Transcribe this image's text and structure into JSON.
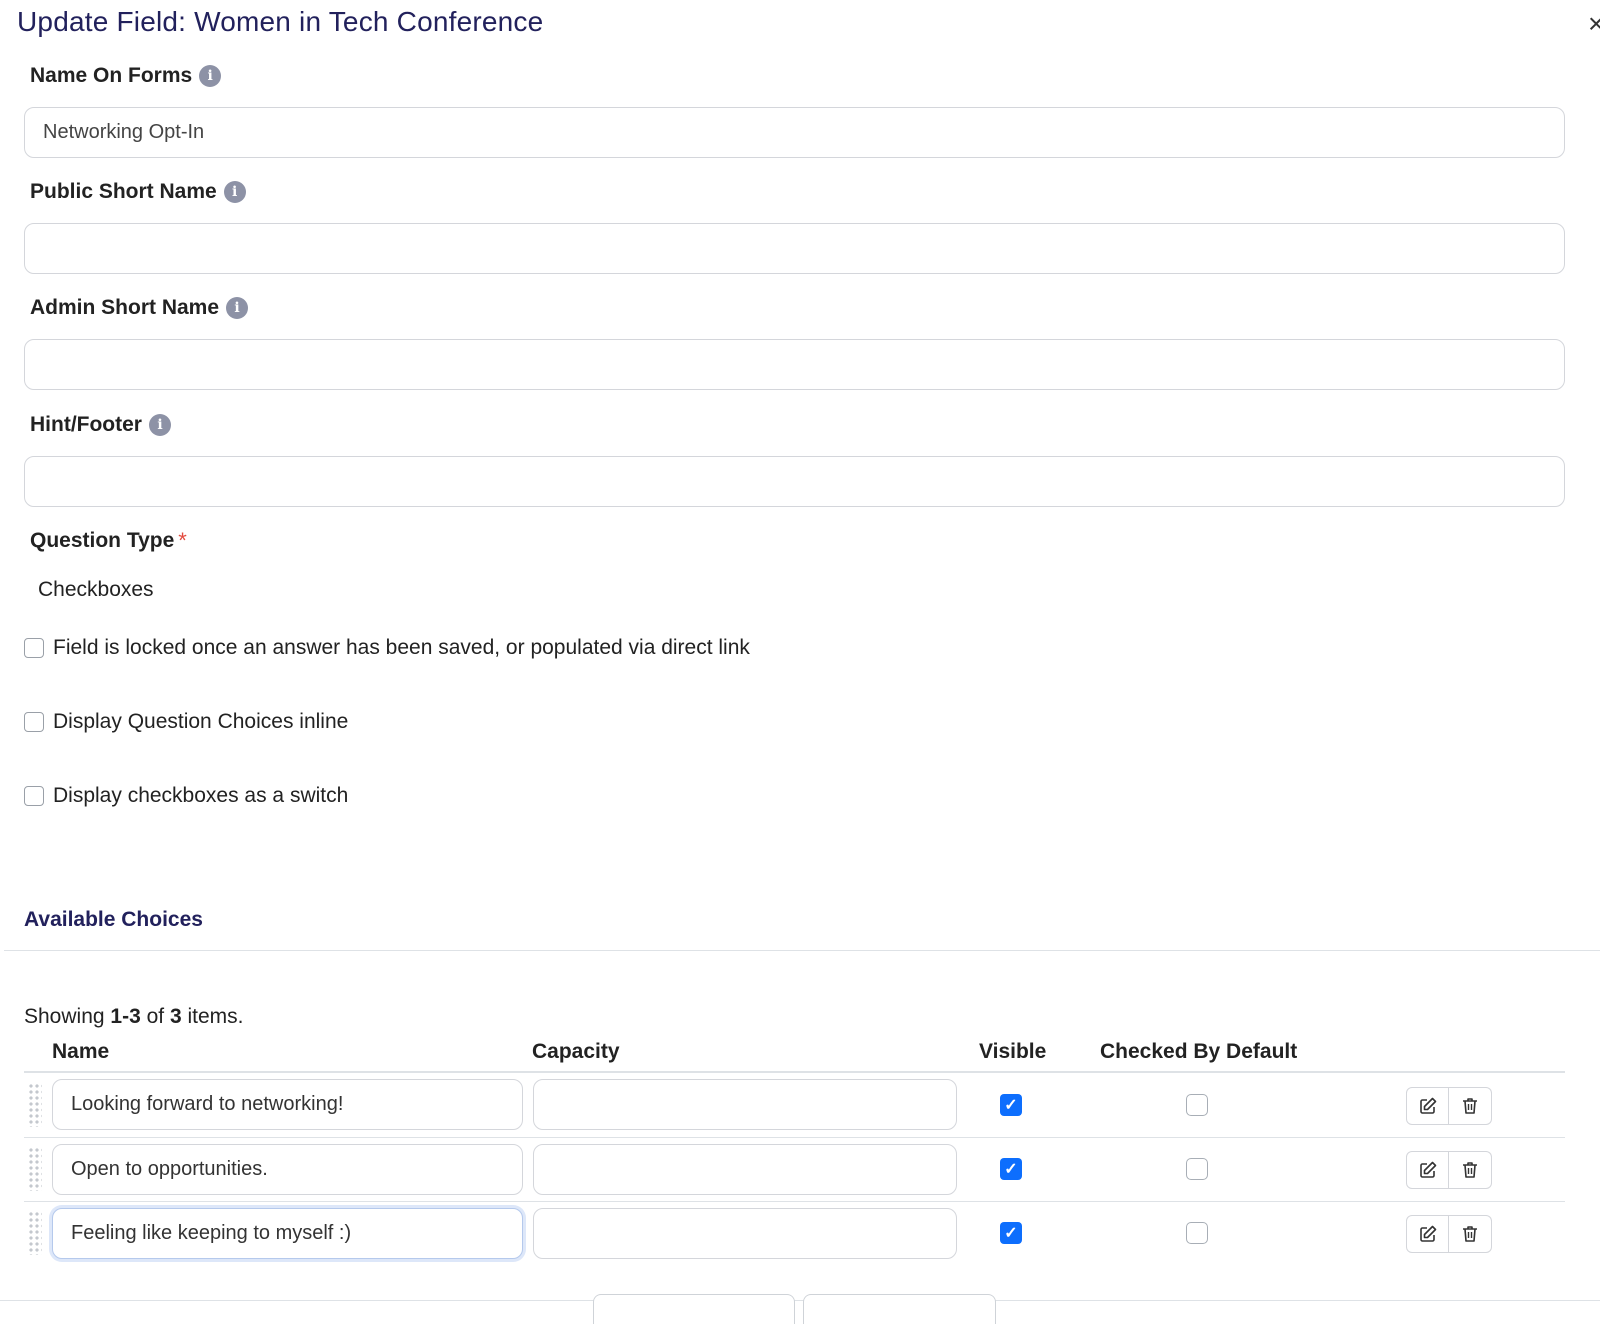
{
  "modal": {
    "title": "Update Field: Women in Tech Conference",
    "close_label": "×"
  },
  "fields": {
    "name_on_forms": {
      "label": "Name On Forms",
      "value": "Networking Opt-In"
    },
    "public_short_name": {
      "label": "Public Short Name",
      "value": ""
    },
    "admin_short_name": {
      "label": "Admin Short Name",
      "value": ""
    },
    "hint_footer": {
      "label": "Hint/Footer",
      "value": ""
    },
    "question_type": {
      "label": "Question Type",
      "required_mark": "*",
      "value": "Checkboxes"
    }
  },
  "info_glyph": "i",
  "options": {
    "locked": {
      "label": "Field is locked once an answer has been saved, or populated via direct link",
      "checked": false
    },
    "inline": {
      "label": "Display Question Choices inline",
      "checked": false
    },
    "switch": {
      "label": "Display checkboxes as a switch",
      "checked": false
    }
  },
  "choices": {
    "section_title": "Available Choices",
    "summary": {
      "prefix": "Showing ",
      "range": "1-3",
      "of": " of ",
      "total": "3",
      "suffix": " items."
    },
    "columns": {
      "name": "Name",
      "capacity": "Capacity",
      "visible": "Visible",
      "checked_by_default": "Checked By Default"
    },
    "rows": [
      {
        "name": "Looking forward to networking!",
        "capacity": "",
        "visible": true,
        "checked_by_default": false
      },
      {
        "name": "Open to opportunities.",
        "capacity": "",
        "visible": true,
        "checked_by_default": false
      },
      {
        "name": "Feeling like keeping to myself :)",
        "capacity": "",
        "visible": true,
        "checked_by_default": false
      }
    ],
    "check_glyph": "✓"
  },
  "icons": {
    "edit": "edit-icon",
    "delete": "trash-icon",
    "drag": "drag-handle-icon",
    "info": "info-icon",
    "close": "close-icon"
  },
  "colors": {
    "title": "#22215c",
    "accent": "#0d6efd",
    "required": "#e34b3f",
    "info_badge": "#8d92a6"
  }
}
